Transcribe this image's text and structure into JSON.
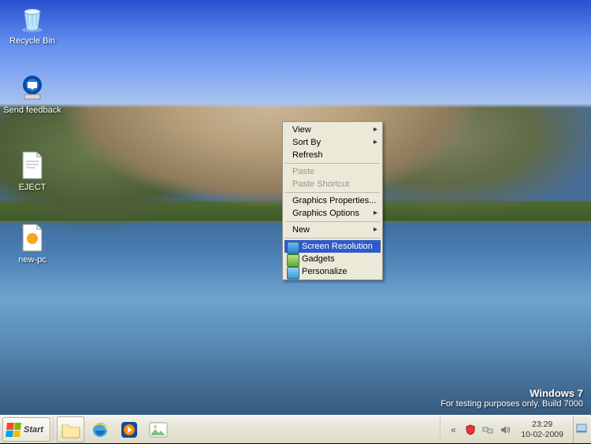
{
  "desktop_icons": [
    {
      "id": "recycle-bin",
      "label": "Recycle Bin"
    },
    {
      "id": "send-feedback",
      "label": "Send feedback"
    },
    {
      "id": "eject",
      "label": "EJECT"
    },
    {
      "id": "new-pc",
      "label": "new-pc"
    }
  ],
  "context_menu": {
    "view": "View",
    "sort_by": "Sort By",
    "refresh": "Refresh",
    "paste": "Paste",
    "paste_shortcut": "Paste Shortcut",
    "graphics_properties": "Graphics Properties...",
    "graphics_options": "Graphics Options",
    "new": "New",
    "screen_resolution": "Screen Resolution",
    "gadgets": "Gadgets",
    "personalize": "Personalize"
  },
  "watermark": {
    "title": "Windows  7",
    "subtitle": "For testing purposes only. Build 7000"
  },
  "taskbar": {
    "start": "Start",
    "tray_chevron": "«",
    "clock_time": "23:29",
    "clock_date": "10-02-2009"
  }
}
